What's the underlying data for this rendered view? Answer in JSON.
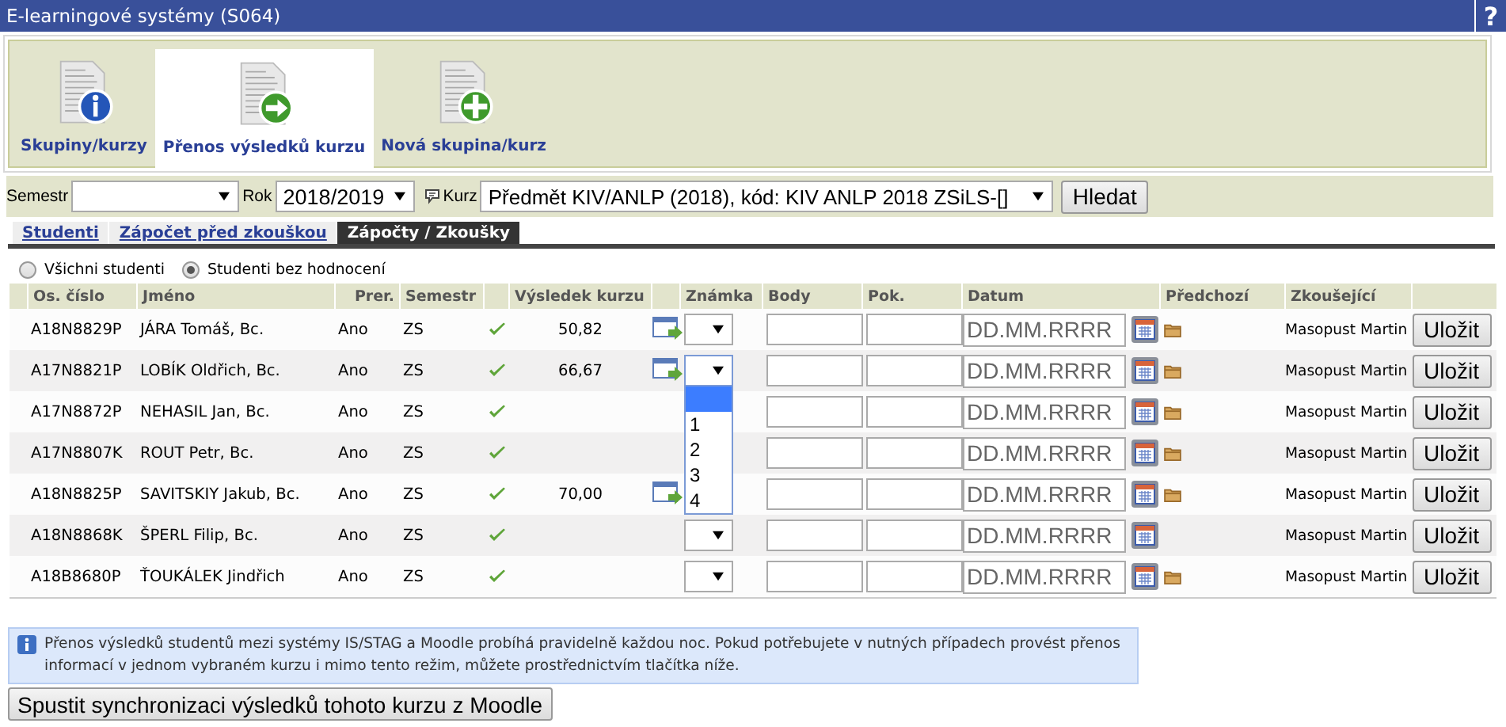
{
  "window": {
    "title": "E-learningové systémy (S064)",
    "help": "?"
  },
  "nav_tabs": [
    {
      "label": "Skupiny/kurzy",
      "kind": "info",
      "selected": false
    },
    {
      "label": "Přenos výsledků kurzu",
      "kind": "arrow",
      "selected": true
    },
    {
      "label": "Nová skupina/kurz",
      "kind": "plus",
      "selected": false
    }
  ],
  "filter": {
    "semestr_label": "Semestr",
    "rok_label": "Rok",
    "rok_value": "2018/2019",
    "kurz_label": "Kurz",
    "kurz_value": "Předmět KIV/ANLP (2018), kód: KIV ANLP 2018 ZSiLS-[]",
    "search_button": "Hledat"
  },
  "sub_tabs": [
    {
      "label": "Studenti",
      "selected": false
    },
    {
      "label": "Zápočet před zkouškou",
      "selected": false
    },
    {
      "label": "Zápočty / Zkoušky",
      "selected": true
    }
  ],
  "filter_radios": [
    {
      "label": "Všichni studenti",
      "selected": false
    },
    {
      "label": "Studenti bez hodnocení",
      "selected": true
    }
  ],
  "table": {
    "columns": [
      "Os. číslo",
      "Jméno",
      "Prer.",
      "Semestr",
      "Výsledek kurzu",
      "Známka",
      "Body",
      "Pok.",
      "Datum",
      "Předchozí",
      "Zkoušející"
    ],
    "rows": [
      {
        "id": "A18N8829P",
        "name": "JÁRA Tomáš, Bc.",
        "prer": "Ano",
        "semestr": "ZS",
        "result": "50,82",
        "transfer": true,
        "grade_select": true,
        "date_placeholder": "DD.MM.RRRR",
        "previous": true,
        "examiner": "Masopust Martin",
        "save": "Uložit"
      },
      {
        "id": "A17N8821P",
        "name": "LOBÍK Oldřich, Bc.",
        "prer": "Ano",
        "semestr": "ZS",
        "result": "66,67",
        "transfer": true,
        "grade_select": true,
        "grade_menu": {
          "blank_highlighted": true,
          "options": [
            "1",
            "2",
            "3",
            "4"
          ]
        },
        "date_placeholder": "DD.MM.RRRR",
        "previous": true,
        "examiner": "Masopust Martin",
        "save": "Uložit"
      },
      {
        "id": "A17N8872P",
        "name": "NEHASIL Jan, Bc.",
        "prer": "Ano",
        "semestr": "ZS",
        "transfer": false,
        "grade_select": false,
        "date_placeholder": "DD.MM.RRRR",
        "previous": true,
        "examiner": "Masopust Martin",
        "save": "Uložit"
      },
      {
        "id": "A17N8807K",
        "name": "ROUT Petr, Bc.",
        "prer": "Ano",
        "semestr": "ZS",
        "transfer": false,
        "grade_select": false,
        "date_placeholder": "DD.MM.RRRR",
        "previous": true,
        "examiner": "Masopust Martin",
        "save": "Uložit"
      },
      {
        "id": "A18N8825P",
        "name": "SAVITSKIY Jakub, Bc.",
        "prer": "Ano",
        "semestr": "ZS",
        "result": "70,00",
        "transfer": true,
        "grade_select": false,
        "date_placeholder": "DD.MM.RRRR",
        "previous": true,
        "examiner": "Masopust Martin",
        "save": "Uložit"
      },
      {
        "id": "A18N8868K",
        "name": "ŠPERL Filip, Bc.",
        "prer": "Ano",
        "semestr": "ZS",
        "transfer": false,
        "grade_select": true,
        "date_placeholder": "DD.MM.RRRR",
        "previous": false,
        "examiner": "Masopust Martin",
        "save": "Uložit"
      },
      {
        "id": "A18B8680P",
        "name": "ŤOUKÁLEK Jindřich",
        "prer": "Ano",
        "semestr": "ZS",
        "transfer": false,
        "grade_select": true,
        "date_placeholder": "DD.MM.RRRR",
        "previous": true,
        "examiner": "Masopust Martin",
        "save": "Uložit"
      }
    ]
  },
  "info": "Přenos výsledků studentů mezi systémy IS/STAG a Moodle probíhá pravidelně každou noc. Pokud potřebujete v nutných případech provést přenos informací v jednom vybraném kurzu i mimo tento režim, můžete prostřednictvím tlačítka níže.",
  "sync_button": "Spustit synchronizaci výsledků tohoto kurzu z Moodle"
}
